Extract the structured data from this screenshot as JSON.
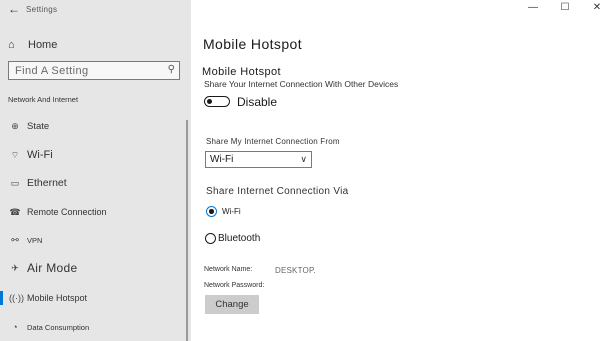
{
  "window": {
    "app_title": "Settings",
    "minimize_glyph": "—",
    "maximize_glyph": "☐",
    "close_glyph": "✕",
    "back_glyph": "←"
  },
  "sidebar": {
    "home_label": "Home",
    "home_icon": "home-icon",
    "search_placeholder": "Find A Setting",
    "section_heading": "Network And Internet",
    "items": [
      {
        "label": "State",
        "icon": "globe-icon"
      },
      {
        "label": "Wi-Fi",
        "icon": "wifi-icon"
      },
      {
        "label": "Ethernet",
        "icon": "ethernet-icon"
      },
      {
        "label": "Remote Connection",
        "icon": "dialup-icon"
      },
      {
        "label": "VPN",
        "icon": "vpn-icon"
      },
      {
        "label": "Air Mode",
        "icon": "airplane-icon"
      },
      {
        "label": "Mobile Hotspot",
        "icon": "hotspot-icon"
      },
      {
        "label": "Data Consumption",
        "icon": "data-usage-icon"
      }
    ],
    "active_index": 6
  },
  "main": {
    "page_title": "Mobile Hotspot",
    "subtitle": "Mobile Hotspot",
    "description": "Share Your Internet Connection With Other Devices",
    "toggle_label": "Disable",
    "share_from_label": "Share My Internet Connection From",
    "share_from_value": "Wi-Fi",
    "share_via_label": "Share Internet Connection Via",
    "radio_options": [
      {
        "label": "Wi-Fi",
        "checked": true
      },
      {
        "label": "Bluetooth",
        "checked": false
      }
    ],
    "network_name_label": "Network Name:",
    "network_name_value": "DESKTOP.",
    "network_password_label": "Network Password:",
    "change_button": "Change"
  },
  "colors": {
    "accent": "#0078d7",
    "sidebar_bg": "#e6e6e6",
    "button_bg": "#cccccc"
  }
}
